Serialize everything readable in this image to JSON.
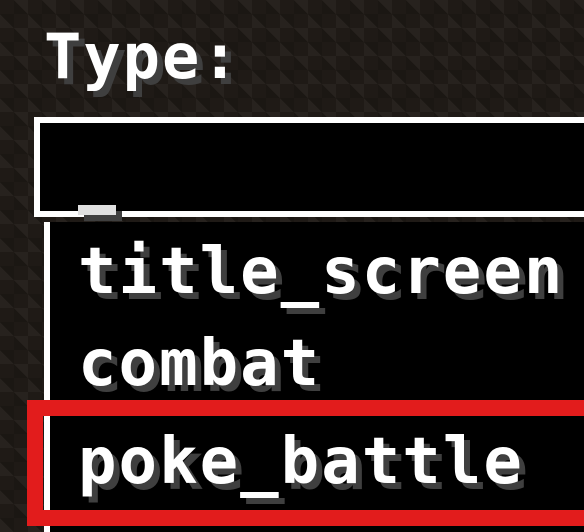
{
  "form": {
    "type_label": "Type:",
    "type_input_value": ""
  },
  "dropdown": {
    "options": [
      {
        "label": "title_screen"
      },
      {
        "label": "combat"
      },
      {
        "label": "poke_battle",
        "highlighted": true
      }
    ]
  },
  "colors": {
    "text": "#ffffff",
    "text_shadow": "#3f3f3f",
    "highlight_border": "#e21c1c",
    "panel_background": "#000000"
  }
}
